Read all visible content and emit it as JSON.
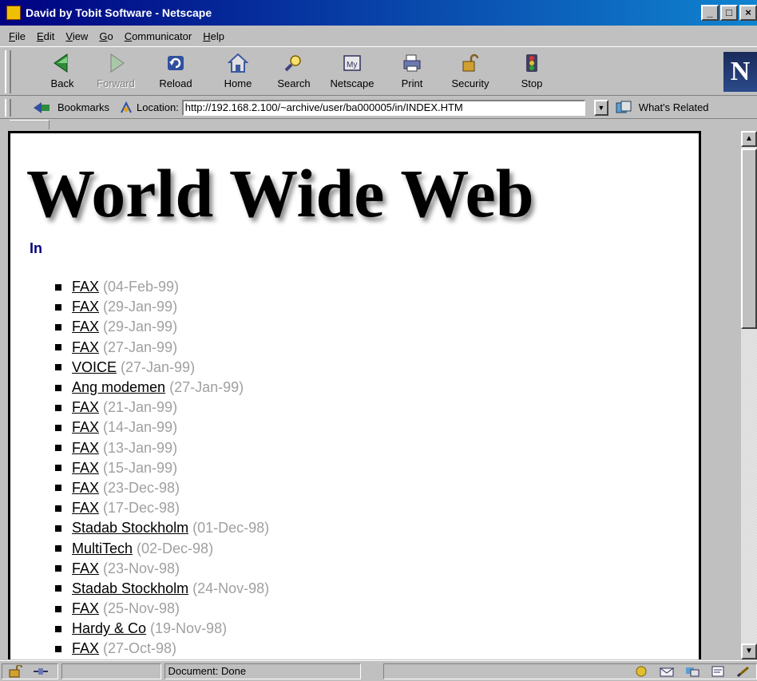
{
  "window": {
    "title": "David by Tobit Software - Netscape"
  },
  "menubar": [
    {
      "u": "F",
      "rest": "ile"
    },
    {
      "u": "E",
      "rest": "dit"
    },
    {
      "u": "V",
      "rest": "iew"
    },
    {
      "u": "G",
      "rest": "o"
    },
    {
      "u": "C",
      "rest": "ommunicator"
    },
    {
      "u": "H",
      "rest": "elp"
    }
  ],
  "toolbar": {
    "back": "Back",
    "forward": "Forward",
    "reload": "Reload",
    "home": "Home",
    "search": "Search",
    "netscape": "Netscape",
    "print": "Print",
    "security": "Security",
    "stop": "Stop",
    "logo": "N"
  },
  "location_bar": {
    "bookmarks_label": "Bookmarks",
    "location_label": "Location:",
    "url": "http://192.168.2.100/~archive/user/ba000005/in/INDEX.HTM",
    "related_label": "What's Related"
  },
  "page": {
    "heading": "World Wide Web",
    "section_label": "In",
    "messages": [
      {
        "title": "FAX",
        "date": "(04-Feb-99)"
      },
      {
        "title": "FAX",
        "date": "(29-Jan-99)"
      },
      {
        "title": "FAX",
        "date": "(29-Jan-99)"
      },
      {
        "title": "FAX",
        "date": "(27-Jan-99)"
      },
      {
        "title": "VOICE",
        "date": "(27-Jan-99)"
      },
      {
        "title": "Ang modemen",
        "date": "(27-Jan-99)"
      },
      {
        "title": "FAX",
        "date": "(21-Jan-99)"
      },
      {
        "title": "FAX",
        "date": "(14-Jan-99)"
      },
      {
        "title": "FAX",
        "date": "(13-Jan-99)"
      },
      {
        "title": "FAX",
        "date": "(15-Jan-99)"
      },
      {
        "title": "FAX",
        "date": "(23-Dec-98)"
      },
      {
        "title": "FAX",
        "date": "(17-Dec-98)"
      },
      {
        "title": "Stadab Stockholm",
        "date": "(01-Dec-98)"
      },
      {
        "title": "MultiTech",
        "date": "(02-Dec-98)"
      },
      {
        "title": "FAX",
        "date": "(23-Nov-98)"
      },
      {
        "title": "Stadab Stockholm",
        "date": "(24-Nov-98)"
      },
      {
        "title": "FAX",
        "date": "(25-Nov-98)"
      },
      {
        "title": "Hardy & Co",
        "date": "(19-Nov-98)"
      },
      {
        "title": "FAX",
        "date": "(27-Oct-98)"
      }
    ]
  },
  "statusbar": {
    "text": "Document: Done"
  },
  "window_buttons": {
    "minimize": "_",
    "maximize": "□",
    "close": "×"
  },
  "colors": {
    "titlebar": "#000080",
    "section_link": "#000080",
    "date_text": "#a0a0a0"
  }
}
